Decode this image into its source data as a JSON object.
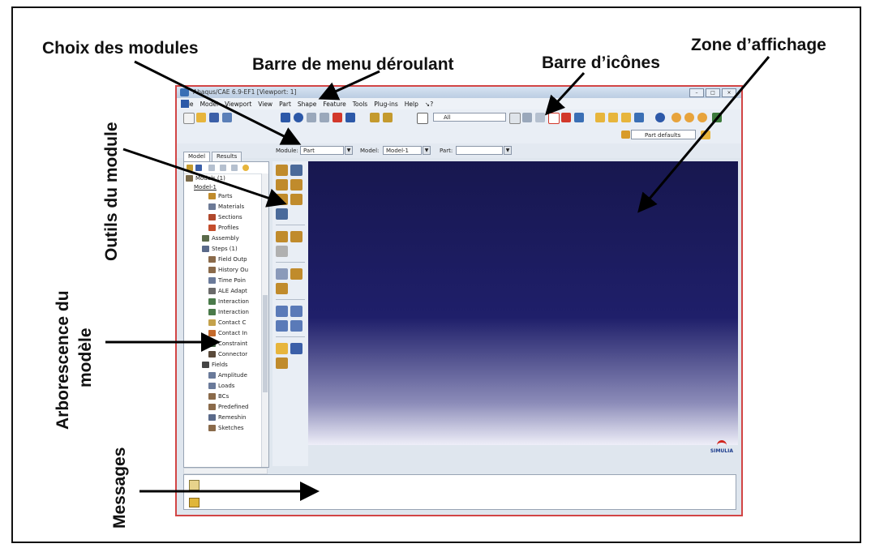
{
  "annotations": {
    "choix_modules": "Choix des modules",
    "barre_menu": "Barre de menu déroulant",
    "barre_icones": "Barre d’icônes",
    "zone_affichage": "Zone d’affichage",
    "outils_module": "Outils du module",
    "arborescence_line1": "Arborescence du",
    "arborescence_line2": "modèle",
    "messages": "Messages"
  },
  "window": {
    "title": "Abaqus/CAE 6.9-EF1 [Viewport: 1]",
    "menu": [
      "File",
      "Model",
      "Viewport",
      "View",
      "Part",
      "Shape",
      "Feature",
      "Tools",
      "Plug-ins",
      "Help",
      "↘?"
    ],
    "toolbar_select": "All",
    "part_defaults": "Part defaults",
    "context": {
      "module_label": "Module:",
      "module_value": "Part",
      "model_label": "Model:",
      "model_value": "Model-1",
      "part_label": "Part:",
      "part_value": ""
    },
    "tabs": [
      "Model",
      "Results"
    ],
    "tree": {
      "root": "Models (1)",
      "model": "Model-1",
      "items": [
        "Parts",
        "Materials",
        "Sections",
        "Profiles",
        "Assembly",
        "Steps (1)",
        "Field Outp",
        "History Ou",
        "Time Poin",
        "ALE Adapt",
        "Interaction",
        "Interaction",
        "Contact C",
        "Contact In",
        "Constraint",
        "Connector",
        "Fields",
        "Amplitude",
        "Loads",
        "BCs",
        "Predefined",
        "Remeshin",
        "Sketches"
      ]
    },
    "brand": "SIMULIA"
  },
  "colors": {
    "frame_border": "#111111",
    "window_border": "#d24545",
    "viewport_top": "#17174f",
    "viewport_bottom": "#eeeef8"
  }
}
